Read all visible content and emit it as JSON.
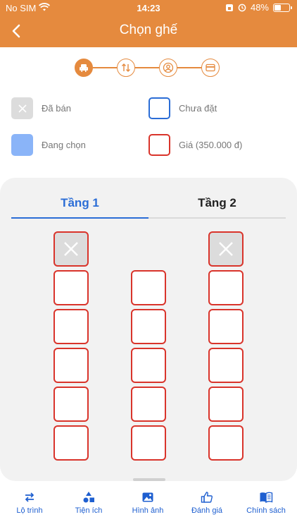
{
  "status_bar": {
    "carrier": "No SIM",
    "time": "14:23",
    "battery": "48%",
    "battery_level": 0.48
  },
  "header": {
    "title": "Chọn ghế"
  },
  "stepper": {
    "steps": [
      "seat-icon",
      "swap-icon",
      "profile-icon",
      "card-icon"
    ],
    "active_step": 0
  },
  "legend": {
    "sold": "Đã bán",
    "empty": "Chưa đặt",
    "selecting": "Đang chọn",
    "price": "Giá (350.000 đ)"
  },
  "tabs": [
    {
      "label": "Tầng 1"
    },
    {
      "label": "Tầng 2"
    }
  ],
  "active_tab": 0,
  "seat_map": {
    "rows": [
      [
        "sold",
        null,
        "sold"
      ],
      [
        "available",
        "available",
        "available"
      ],
      [
        "available",
        "available",
        "available"
      ],
      [
        "available",
        "available",
        "available"
      ],
      [
        "available",
        "available",
        "available"
      ],
      [
        "available",
        "available",
        "available"
      ]
    ]
  },
  "bottom_nav": [
    {
      "label": "Lộ trình",
      "icon": "route-swap-icon"
    },
    {
      "label": "Tiện ích",
      "icon": "shapes-icon"
    },
    {
      "label": "Hình ảnh",
      "icon": "image-icon"
    },
    {
      "label": "Đánh giá",
      "icon": "thumbs-up-icon"
    },
    {
      "label": "Chính sách",
      "icon": "book-icon"
    }
  ],
  "colors": {
    "brand": "#E58A3E",
    "accent_blue": "#2B6DD6",
    "seat_border": "#D9342B",
    "sold_bg": "#DCDCDC",
    "selecting": "#8AB4F8"
  }
}
